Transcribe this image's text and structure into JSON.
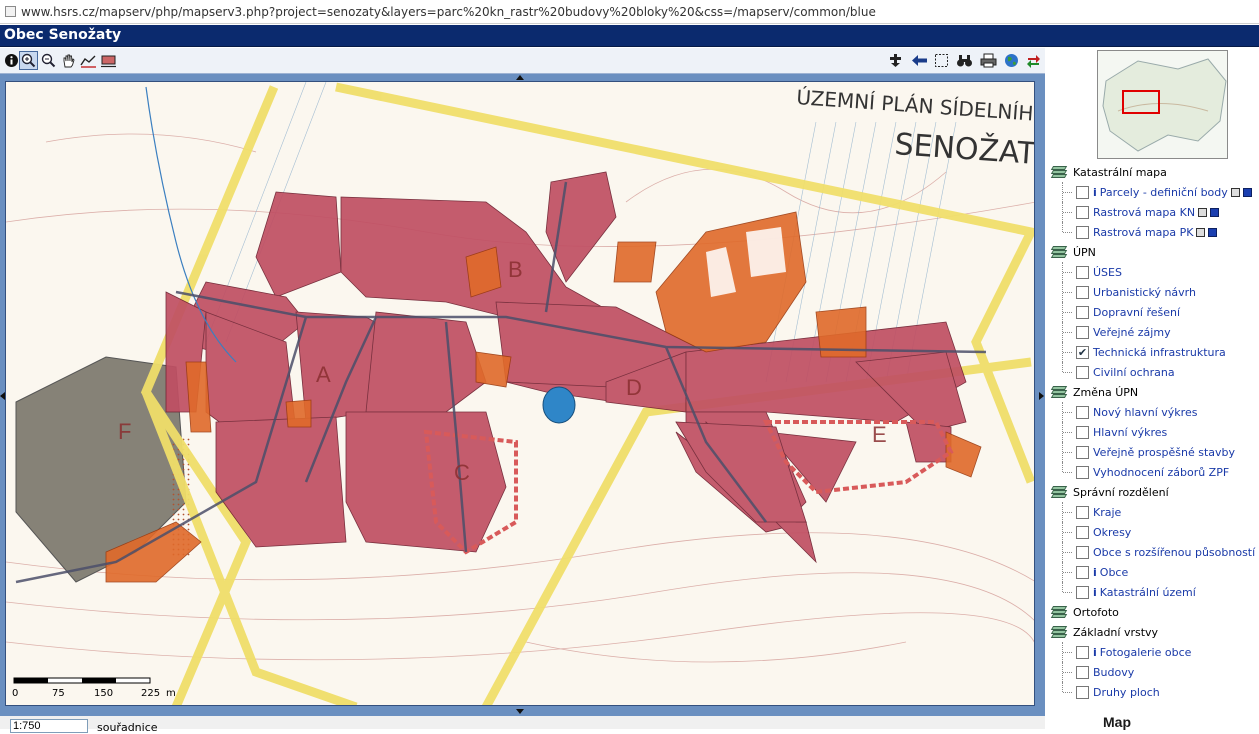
{
  "browser": {
    "url": "www.hsrs.cz/mapserv/php/mapserv3.php?project=senozaty&layers=parc%20kn_rastr%20budovy%20bloky%20&css=/mapserv/common/blue"
  },
  "app": {
    "title": "Obec Senožaty"
  },
  "toolbar": {
    "left_tools": [
      {
        "name": "info-tool",
        "icon": "info-icon"
      },
      {
        "name": "zoom-in-tool",
        "icon": "zoom-in-icon"
      },
      {
        "name": "zoom-out-tool",
        "icon": "zoom-out-icon"
      },
      {
        "name": "pan-tool",
        "icon": "hand-icon"
      },
      {
        "name": "measure-tool",
        "icon": "measure-icon"
      },
      {
        "name": "area-tool",
        "icon": "area-icon"
      }
    ],
    "right_tools": [
      {
        "name": "add-tool",
        "icon": "add-icon"
      },
      {
        "name": "back-tool",
        "icon": "back-arrow-icon"
      },
      {
        "name": "select-tool",
        "icon": "select-rectangle-icon"
      },
      {
        "name": "search-tool",
        "icon": "binoculars-icon"
      },
      {
        "name": "print-tool",
        "icon": "printer-icon"
      },
      {
        "name": "globe-tool",
        "icon": "globe-icon"
      },
      {
        "name": "refresh-tool",
        "icon": "refresh-icon"
      }
    ]
  },
  "map": {
    "labels": {
      "plan_title": "ÚZEMNÍ PLÁN SÍDELNÍHO",
      "village": "SENOŽATY",
      "area_a": "A",
      "area_b": "B",
      "area_c": "C",
      "area_d": "D",
      "area_e": "E",
      "area_f": "F"
    },
    "scalebar": {
      "ticks": [
        "0",
        "75",
        "150",
        "225"
      ],
      "unit": "m"
    }
  },
  "status": {
    "scale_value": "1:750",
    "coords_label": "souřadnice"
  },
  "legend": {
    "groups": [
      {
        "name": "Katastrální mapa",
        "layers": [
          {
            "label": "Parcely - definiční body",
            "info": true,
            "checked": false,
            "badges": true
          },
          {
            "label": "Rastrová mapa KN",
            "info": false,
            "checked": false,
            "badges": true
          },
          {
            "label": "Rastrová mapa PK",
            "info": false,
            "checked": false,
            "badges": true
          }
        ]
      },
      {
        "name": "ÚPN",
        "layers": [
          {
            "label": "ÚSES",
            "checked": false
          },
          {
            "label": "Urbanistický návrh",
            "checked": false
          },
          {
            "label": "Dopravní řešení",
            "checked": false
          },
          {
            "label": "Veřejné zájmy",
            "checked": false
          },
          {
            "label": "Technická infrastruktura",
            "checked": true
          },
          {
            "label": "Civilní ochrana",
            "checked": false
          }
        ]
      },
      {
        "name": "Změna ÚPN",
        "layers": [
          {
            "label": "Nový hlavní výkres",
            "checked": false
          },
          {
            "label": "Hlavní výkres",
            "checked": false
          },
          {
            "label": "Veřejně prospěšné stavby",
            "checked": false
          },
          {
            "label": "Vyhodnocení záborů ZPF",
            "checked": false
          }
        ]
      },
      {
        "name": "Správní rozdělení",
        "layers": [
          {
            "label": "Kraje",
            "checked": false
          },
          {
            "label": "Okresy",
            "checked": false
          },
          {
            "label": "Obce s rozšířenou působností",
            "checked": false
          },
          {
            "label": "Obce",
            "info": true,
            "checked": false
          },
          {
            "label": "Katastrální území",
            "info": true,
            "checked": false
          }
        ]
      },
      {
        "name": "Ortofoto",
        "layers": []
      },
      {
        "name": "Základní vrstvy",
        "layers": [
          {
            "label": "Fotogalerie obce",
            "info": true,
            "checked": false
          },
          {
            "label": "Budovy",
            "checked": false
          },
          {
            "label": "Druhy ploch",
            "checked": false
          }
        ]
      }
    ]
  },
  "logo": {
    "text": "Map"
  }
}
